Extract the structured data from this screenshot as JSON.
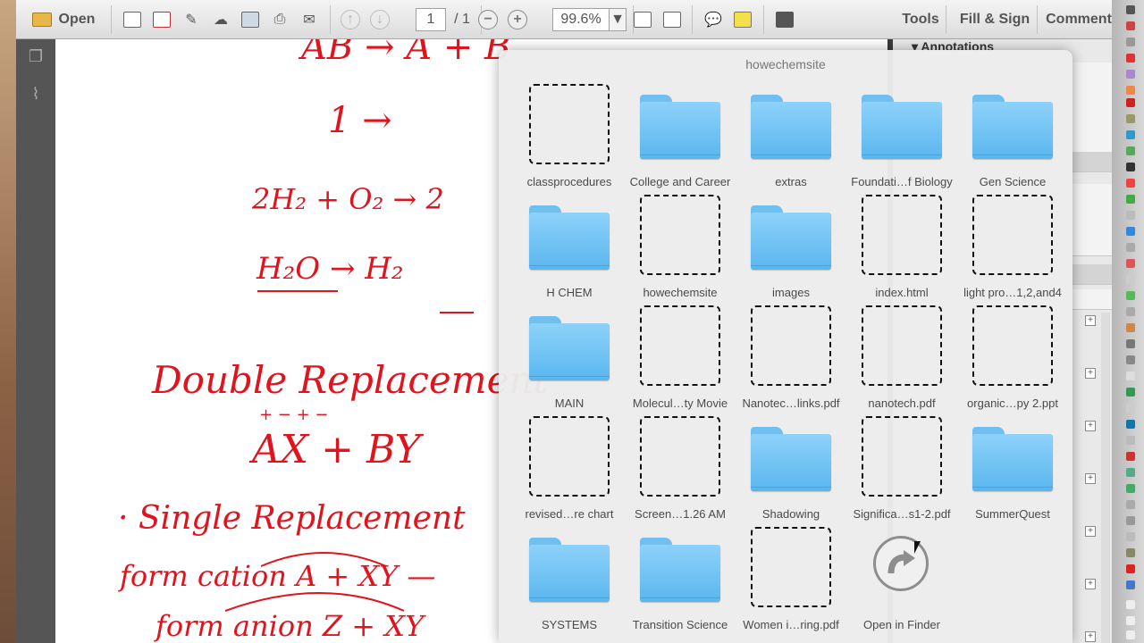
{
  "toolbar": {
    "open_label": "Open",
    "page_current": "1",
    "page_total": "/ 1",
    "zoom_value": "99.6%",
    "tools_label": "Tools",
    "fill_sign_label": "Fill & Sign",
    "comment_label": "Comment"
  },
  "right_panel": {
    "annotations_label": "Annotations"
  },
  "stack": {
    "title": "howechemsite",
    "items": [
      {
        "label": "classprocedures",
        "kind": "file"
      },
      {
        "label": "College and Career",
        "kind": "folder"
      },
      {
        "label": "extras",
        "kind": "folder"
      },
      {
        "label": "Foundati…f Biology",
        "kind": "folder"
      },
      {
        "label": "Gen Science",
        "kind": "folder"
      },
      {
        "label": "H CHEM",
        "kind": "folder"
      },
      {
        "label": "howechemsite",
        "kind": "file"
      },
      {
        "label": "images",
        "kind": "folder"
      },
      {
        "label": "index.html",
        "kind": "file"
      },
      {
        "label": "light pro…1,2,and4",
        "kind": "file"
      },
      {
        "label": "MAIN",
        "kind": "folder"
      },
      {
        "label": "Molecul…ty Movie",
        "kind": "file"
      },
      {
        "label": "Nanotec…links.pdf",
        "kind": "file"
      },
      {
        "label": "nanotech.pdf",
        "kind": "file"
      },
      {
        "label": "organic…py 2.ppt",
        "kind": "file"
      },
      {
        "label": "revised…re chart",
        "kind": "file"
      },
      {
        "label": "Screen…1.26 AM",
        "kind": "file"
      },
      {
        "label": "Shadowing",
        "kind": "folder"
      },
      {
        "label": "Significa…s1-2.pdf",
        "kind": "file"
      },
      {
        "label": "SummerQuest",
        "kind": "folder"
      },
      {
        "label": "SYSTEMS",
        "kind": "folder"
      },
      {
        "label": "Transition Science",
        "kind": "folder"
      },
      {
        "label": "Women i…ring.pdf",
        "kind": "file"
      },
      {
        "label": "Open in Finder",
        "kind": "finder"
      }
    ]
  },
  "document": {
    "lines": [
      {
        "text": "AB  →  A + B"
      },
      {
        "text": "1  →"
      },
      {
        "text": "2H₂ + O₂  →  2"
      },
      {
        "text": "H₂O  →  H₂"
      },
      {
        "text": "Double  Replacement"
      },
      {
        "text": "+  −       +  −"
      },
      {
        "text": "AX  +  BY"
      },
      {
        "text": "·  Single  Replacement"
      },
      {
        "text": "form cation  A  +  XY  —"
      },
      {
        "text": "form anion  Z  +  XY"
      }
    ]
  },
  "colors": {
    "ink": "#e0141e",
    "folder": "#6cc3f5",
    "toolbar_accent": "#3f6f9c"
  }
}
